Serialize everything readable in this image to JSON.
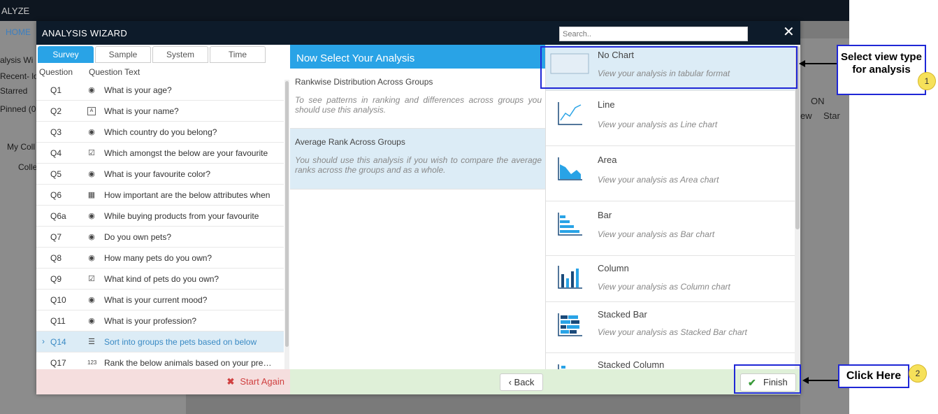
{
  "background": {
    "brand": "ALYZE",
    "side_items": [
      "HOME",
      "alysis Wi",
      "Recent- lo",
      "Starred",
      "Pinned (0",
      "My Coll",
      "Colle"
    ],
    "right_labels": [
      "ON",
      "ew",
      "Star"
    ]
  },
  "modal": {
    "title": "ANALYSIS WIZARD",
    "search_placeholder": "Search.."
  },
  "tabs": [
    "Survey",
    "Sample",
    "System",
    "Time"
  ],
  "question_headers": {
    "id": "Question",
    "text": "Question Text"
  },
  "questions": [
    {
      "id": "Q1",
      "icon": "radio-icon",
      "text": "What is your age?"
    },
    {
      "id": "Q2",
      "icon": "text-icon",
      "text": "What is your name?"
    },
    {
      "id": "Q3",
      "icon": "radio-icon",
      "text": "Which country do you belong?"
    },
    {
      "id": "Q4",
      "icon": "checkbox-icon",
      "text": "Which amongst the below are your favourite"
    },
    {
      "id": "Q5",
      "icon": "radio-icon",
      "text": "What is your favourite color?"
    },
    {
      "id": "Q6",
      "icon": "grid-icon",
      "text": "How important are the below attributes when"
    },
    {
      "id": "Q6a",
      "icon": "radio-icon",
      "text": "While buying products from your favourite"
    },
    {
      "id": "Q7",
      "icon": "radio-icon",
      "text": "Do you own pets?"
    },
    {
      "id": "Q8",
      "icon": "radio-icon",
      "text": "How many pets do you own?"
    },
    {
      "id": "Q9",
      "icon": "checkbox-icon",
      "text": "What kind of pets do you own?"
    },
    {
      "id": "Q10",
      "icon": "radio-icon",
      "text": "What is your current mood?"
    },
    {
      "id": "Q11",
      "icon": "radio-icon",
      "text": "What is your profession?"
    },
    {
      "id": "Q14",
      "icon": "sort-icon",
      "text": "Sort into groups the pets based on below",
      "selected": true
    },
    {
      "id": "Q17",
      "icon": "rank-icon",
      "text": "Rank the below animals based on your preference"
    }
  ],
  "start_again": "Start Again",
  "analysis": {
    "heading": "Now Select Your Analysis",
    "options": [
      {
        "title": "Rankwise Distribution Across Groups",
        "desc": "To see patterns in ranking and differences across groups you should use this analysis."
      },
      {
        "title": "Average Rank Across Groups",
        "desc": "You should use this analysis if you wish to compare the average ranks across the groups and as a whole."
      }
    ]
  },
  "back_label": "Back",
  "view_types": [
    {
      "name": "No Chart",
      "desc": "View your analysis in tabular format"
    },
    {
      "name": "Line",
      "desc": "View your analysis as Line chart"
    },
    {
      "name": "Area",
      "desc": "View your analysis as Area chart"
    },
    {
      "name": "Bar",
      "desc": "View your analysis as Bar chart"
    },
    {
      "name": "Column",
      "desc": "View your analysis as Column chart"
    },
    {
      "name": "Stacked Bar",
      "desc": "View your analysis as Stacked Bar chart"
    },
    {
      "name": "Stacked Column",
      "desc": ""
    }
  ],
  "finish_label": "Finish",
  "annotations": {
    "callout1": "Select view type for analysis",
    "badge1": "1",
    "callout2": "Click Here",
    "badge2": "2"
  },
  "colors": {
    "accent": "#29a3e6",
    "header": "#0d1b2a",
    "annotation": "#1f27d6"
  }
}
